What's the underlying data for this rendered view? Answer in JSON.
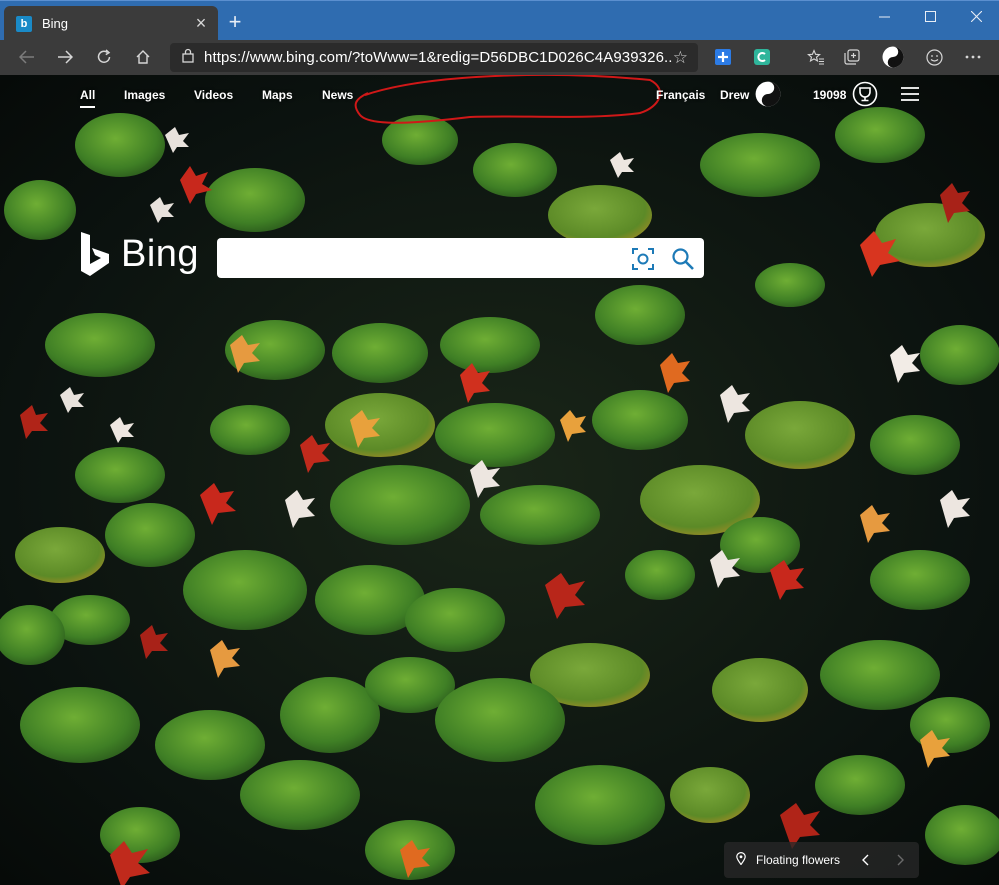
{
  "browser": {
    "tab": {
      "favicon": "b",
      "title": "Bing"
    },
    "address": {
      "url": "https://www.bing.com/?toWww=1&redig=D56DBC1D026C4A939326..."
    }
  },
  "nav": {
    "links": [
      "All",
      "Images",
      "Videos",
      "Maps",
      "News"
    ],
    "language": "Français",
    "user": "Drew",
    "points": "19098"
  },
  "logo": {
    "text": "Bing"
  },
  "search": {
    "placeholder": ""
  },
  "caption": {
    "text": "Floating flowers"
  },
  "colors": {
    "titlebar": "#2f6cb0",
    "toolbar": "#3b3b3b",
    "lily_pad": "#4e8a2a",
    "leaf_red": "#c8281c",
    "annotation": "#d01818"
  },
  "icons": [
    "back-icon",
    "forward-icon",
    "refresh-icon",
    "home-icon",
    "lock-icon",
    "favorite-star-icon",
    "extension-icon",
    "favorites-icon",
    "collections-icon",
    "profile-icon",
    "emoji-icon",
    "more-icon",
    "visual-search-icon",
    "search-icon",
    "rewards-icon",
    "menu-icon",
    "location-pin-icon",
    "chevron-left-icon",
    "chevron-right-icon"
  ]
}
